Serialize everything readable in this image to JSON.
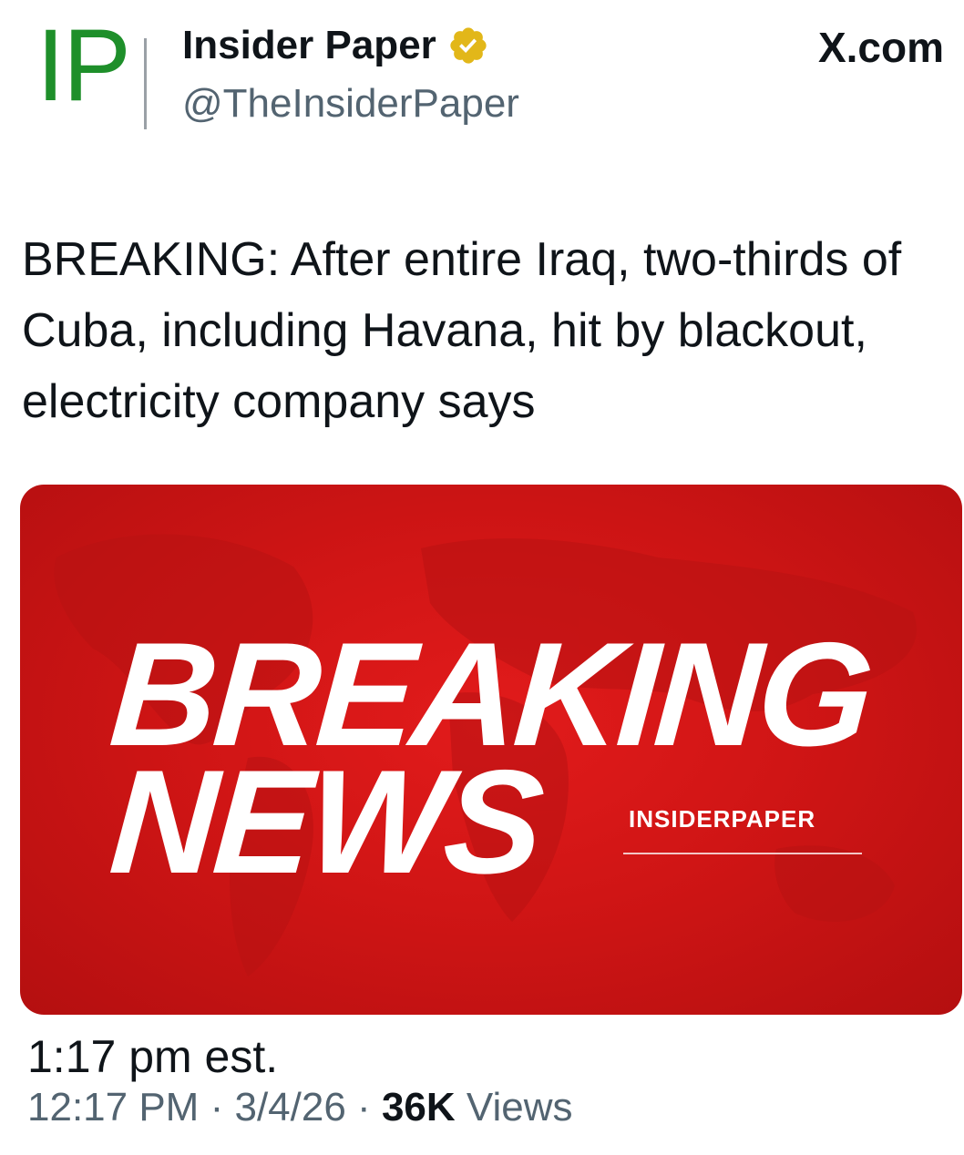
{
  "header": {
    "avatar_text": "IP",
    "display_name": "Insider Paper",
    "handle": "@TheInsiderPaper",
    "site": "X.com",
    "verified_icon": "verified-badge-icon"
  },
  "tweet": {
    "text": "BREAKING: After entire Iraq, two-thirds of Cuba, including Havana, hit by blackout, electricity company says"
  },
  "media": {
    "line1": "BREAKING",
    "line2": "NEWS",
    "brand": "INSIDERPAPER"
  },
  "footer": {
    "annotation": "1:17 pm est.",
    "time": "12:17 PM",
    "sep1": "·",
    "date": "3/4/26",
    "sep2": "·",
    "views_count": "36K",
    "views_label": "Views"
  },
  "colors": {
    "accent_green": "#1e8f2a",
    "verified_gold": "#e2b719",
    "breaking_red": "#d01515"
  }
}
